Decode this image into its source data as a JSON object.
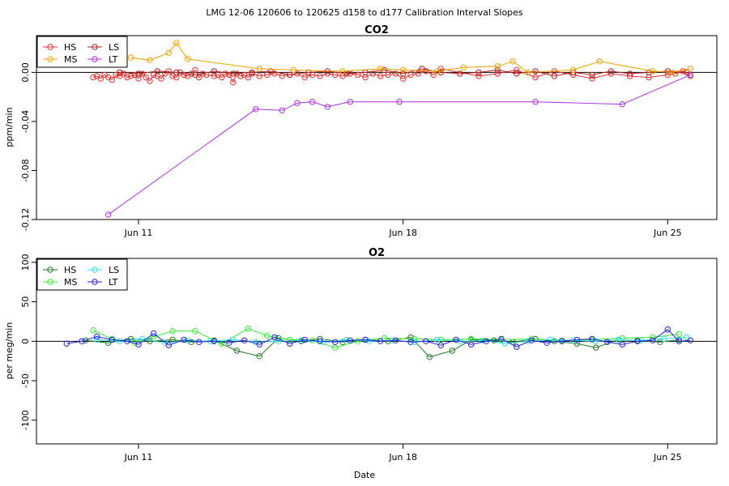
{
  "suptitle": "LMG   12-06    120606 to 120625    d158 to d177   Calibration Interval Slopes",
  "xlabel": "Date",
  "colors": {
    "HS": "#e4312f",
    "LS": "#b22222",
    "MS": "#f0a000",
    "LT": "#b030e0",
    "O2_HS": "#1f7a1f",
    "O2_MS": "#33ee33",
    "O2_LS": "#33e0ee",
    "O2_LT": "#2222dd"
  },
  "chart_data": [
    {
      "type": "line",
      "title": "CO2",
      "ylabel": "ppm/min",
      "xlim": [
        8.3,
        26.3
      ],
      "ylim": [
        -0.12,
        0.03
      ],
      "x_ticks": [
        {
          "v": 11,
          "label": "Jun 11"
        },
        {
          "v": 18,
          "label": "Jun 18"
        },
        {
          "v": 25,
          "label": "Jun 25"
        }
      ],
      "y_ticks": [
        {
          "v": 0,
          "label": "0.00"
        },
        {
          "v": -0.04,
          "label": "-0.04"
        },
        {
          "v": -0.08,
          "label": "-0.08"
        },
        {
          "v": -0.12,
          "label": "-0.12"
        }
      ],
      "hline": 0,
      "legend_position": "top-left",
      "legend": [
        [
          "HS",
          "LS"
        ],
        [
          "MS",
          "LT"
        ]
      ],
      "series": [
        {
          "name": "HS",
          "color": "#e4312f",
          "x": [
            9.8,
            9.9,
            10.0,
            10.1,
            10.2,
            10.3,
            10.4,
            10.5,
            10.6,
            10.7,
            10.8,
            10.9,
            11.0,
            11.1,
            11.2,
            11.3,
            11.4,
            11.5,
            11.6,
            11.7,
            11.8,
            11.9,
            12.0,
            12.1,
            12.2,
            12.3,
            12.4,
            12.5,
            12.6,
            12.7,
            12.8,
            13.0,
            13.1,
            13.2,
            13.3,
            13.4,
            13.5,
            13.6,
            13.7,
            13.8,
            13.9,
            14.0,
            14.2,
            14.4,
            14.6,
            14.8,
            15.0,
            15.2,
            15.4,
            15.6,
            15.8,
            16.0,
            16.2,
            16.4,
            16.6,
            16.8,
            17.0,
            17.2,
            17.4,
            17.6,
            17.8,
            18.0,
            18.2,
            18.4,
            18.6,
            18.8,
            19.0,
            20.0,
            20.5,
            21.0,
            21.5,
            22.0,
            22.5,
            23.0,
            23.5,
            24.0,
            24.5,
            25.0,
            25.2,
            25.4,
            25.6
          ],
          "y": [
            -0.004,
            -0.003,
            -0.005,
            -0.002,
            -0.004,
            -0.006,
            -0.002,
            -0.003,
            -0.001,
            -0.004,
            -0.003,
            -0.002,
            -0.005,
            -0.001,
            -0.004,
            -0.007,
            -0.002,
            -0.003,
            -0.005,
            -0.001,
            0.001,
            -0.003,
            -0.004,
            0.0,
            -0.002,
            -0.003,
            -0.001,
            0.002,
            -0.004,
            -0.001,
            -0.002,
            -0.003,
            -0.002,
            -0.004,
            -0.001,
            -0.002,
            -0.008,
            -0.001,
            -0.003,
            -0.002,
            -0.004,
            -0.001,
            -0.003,
            -0.002,
            -0.001,
            -0.003,
            -0.002,
            -0.001,
            -0.004,
            -0.002,
            -0.003,
            -0.001,
            -0.002,
            -0.003,
            -0.001,
            -0.002,
            -0.004,
            -0.001,
            -0.003,
            -0.002,
            -0.001,
            -0.005,
            -0.002,
            -0.001,
            0.001,
            -0.002,
            0.003,
            -0.003,
            -0.001,
            0.002,
            -0.004,
            0.001,
            -0.002,
            -0.005,
            -0.001,
            -0.003,
            -0.004,
            -0.002,
            -0.001,
            0.001,
            -0.003
          ]
        },
        {
          "name": "LS",
          "color": "#b22222",
          "x": [
            10.5,
            11.0,
            11.5,
            12.0,
            12.5,
            13.0,
            13.5,
            14.0,
            14.5,
            15.0,
            15.5,
            16.0,
            16.5,
            17.0,
            17.5,
            18.0,
            18.5,
            19.0,
            19.5,
            20.0,
            20.5,
            21.0,
            21.5,
            22.0,
            22.5,
            23.0,
            23.5,
            24.0,
            24.5,
            25.0,
            25.5
          ],
          "y": [
            0.0,
            -0.001,
            0.001,
            0.0,
            -0.002,
            0.001,
            -0.001,
            0.0,
            0.001,
            -0.002,
            0.0,
            0.001,
            -0.001,
            0.0,
            0.002,
            -0.001,
            0.003,
            0.0,
            -0.001,
            0.0,
            0.002,
            -0.001,
            0.001,
            -0.003,
            0.0,
            -0.002,
            0.001,
            -0.001,
            0.0,
            0.001,
            0.0
          ]
        },
        {
          "name": "MS",
          "color": "#f0a000",
          "x": [
            10.8,
            11.3,
            11.8,
            12.0,
            12.3,
            14.2,
            15.1,
            16.4,
            17.4,
            18.0,
            18.9,
            19.6,
            20.5,
            20.9,
            21.3,
            22.5,
            23.2,
            24.6,
            25.1,
            25.6
          ],
          "y": [
            0.012,
            0.01,
            0.016,
            0.024,
            0.011,
            0.003,
            0.002,
            0.001,
            0.003,
            0.002,
            0.001,
            0.004,
            0.005,
            0.009,
            0.0,
            0.002,
            0.009,
            0.001,
            0.0,
            0.003
          ]
        },
        {
          "name": "LT",
          "color": "#b030e0",
          "x": [
            10.2,
            14.1,
            14.8,
            15.2,
            15.6,
            16.0,
            16.6,
            17.9,
            21.5,
            23.8,
            25.6
          ],
          "y": [
            -0.116,
            -0.03,
            -0.031,
            -0.025,
            -0.024,
            -0.028,
            -0.024,
            -0.024,
            -0.024,
            -0.026,
            -0.002
          ]
        }
      ]
    },
    {
      "type": "line",
      "title": "O2",
      "ylabel": "per meg/min",
      "xlim": [
        8.3,
        26.3
      ],
      "ylim": [
        -130,
        105
      ],
      "x_ticks": [
        {
          "v": 11,
          "label": "Jun 11"
        },
        {
          "v": 18,
          "label": "Jun 18"
        },
        {
          "v": 25,
          "label": "Jun 25"
        }
      ],
      "y_ticks": [
        {
          "v": 100,
          "label": "100"
        },
        {
          "v": 50,
          "label": "50"
        },
        {
          "v": 0,
          "label": "0"
        },
        {
          "v": -50,
          "label": "-50"
        },
        {
          "v": -100,
          "label": "-100"
        }
      ],
      "hline": 0,
      "legend_position": "top-left",
      "legend": [
        [
          "HS",
          "LS"
        ],
        [
          "MS",
          "LT"
        ]
      ],
      "series": [
        {
          "name": "HS",
          "color": "#1f7a1f",
          "x": [
            9.6,
            10.2,
            10.8,
            11.3,
            11.9,
            12.4,
            13.0,
            13.6,
            14.2,
            14.7,
            15.3,
            15.8,
            16.4,
            17.0,
            17.6,
            18.2,
            18.7,
            19.3,
            19.8,
            20.4,
            20.9,
            21.5,
            22.0,
            22.6,
            23.1,
            23.7,
            24.2,
            24.8,
            25.3
          ],
          "y": [
            1,
            -2,
            3,
            0,
            2,
            -1,
            1,
            -12,
            -19,
            4,
            0,
            3,
            -1,
            2,
            0,
            5,
            -20,
            -12,
            2,
            1,
            -1,
            3,
            0,
            -3,
            -8,
            2,
            1,
            -1,
            2
          ]
        },
        {
          "name": "MS",
          "color": "#33ee33",
          "x": [
            9.8,
            10.3,
            10.9,
            11.4,
            11.9,
            12.5,
            13.2,
            13.9,
            14.4,
            15.0,
            15.6,
            16.2,
            16.8,
            17.5,
            18.3,
            19.0,
            19.8,
            20.6,
            21.4,
            22.2,
            23.0,
            23.8,
            24.6,
            25.3
          ],
          "y": [
            14,
            3,
            -2,
            6,
            13,
            13,
            -3,
            16,
            7,
            2,
            1,
            -8,
            0,
            4,
            3,
            2,
            3,
            2,
            3,
            1,
            2,
            4,
            5,
            9
          ]
        },
        {
          "name": "LS",
          "color": "#33e0ee",
          "x": [
            9.9,
            10.5,
            11.1,
            11.7,
            12.3,
            12.9,
            13.5,
            14.1,
            14.7,
            15.3,
            15.9,
            16.5,
            17.1,
            17.7,
            18.3,
            18.9,
            19.5,
            20.1,
            20.7,
            21.3,
            21.9,
            22.5,
            23.1,
            23.7,
            24.3,
            24.9,
            25.5
          ],
          "y": [
            2,
            0,
            3,
            -2,
            1,
            0,
            2,
            -1,
            0,
            1,
            -1,
            2,
            0,
            1,
            -1,
            2,
            0,
            1,
            -3,
            0,
            2,
            1,
            0,
            2,
            1,
            3,
            5
          ]
        },
        {
          "name": "LT",
          "color": "#2222dd",
          "x": [
            9.1,
            9.5,
            9.9,
            10.3,
            10.7,
            11.0,
            11.4,
            11.8,
            12.2,
            12.6,
            13.0,
            13.4,
            13.8,
            14.2,
            14.6,
            15.0,
            15.4,
            15.8,
            16.2,
            16.6,
            17.0,
            17.4,
            17.8,
            18.2,
            18.6,
            19.0,
            19.4,
            19.8,
            20.2,
            20.6,
            21.0,
            21.4,
            21.8,
            22.2,
            22.6,
            23.0,
            23.4,
            23.8,
            24.2,
            24.6,
            25.0,
            25.3,
            25.6
          ],
          "y": [
            -3,
            0,
            6,
            2,
            0,
            -4,
            10,
            -5,
            2,
            -1,
            0,
            -2,
            1,
            -4,
            5,
            -3,
            2,
            0,
            -1,
            1,
            2,
            0,
            1,
            -1,
            0,
            -5,
            2,
            -4,
            0,
            3,
            -7,
            1,
            -2,
            0,
            2,
            3,
            -1,
            -4,
            0,
            1,
            15,
            0,
            1
          ]
        }
      ]
    }
  ]
}
